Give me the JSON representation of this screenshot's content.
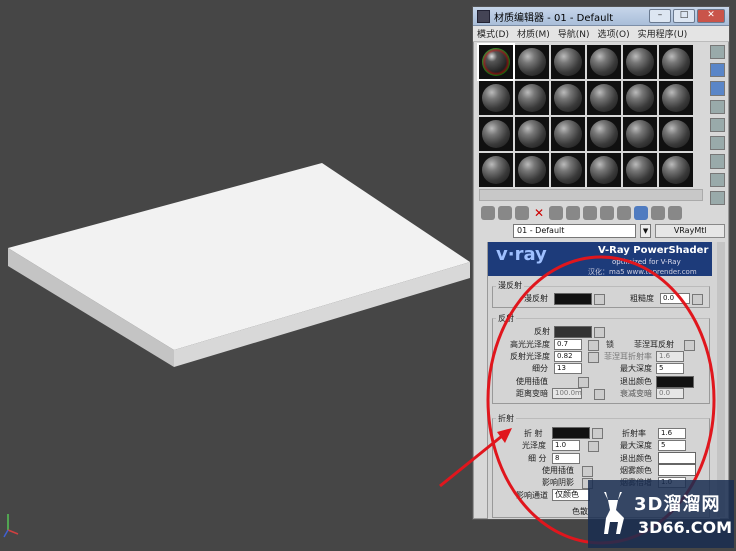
{
  "window": {
    "title": "材质编辑器 - 01 - Default",
    "menu": [
      "模式(D)",
      "材质(M)",
      "导航(N)",
      "选项(O)",
      "实用程序(U)"
    ]
  },
  "material": {
    "name": "01 - Default",
    "type_button": "VRayMtl"
  },
  "banner": {
    "brand": "v·ray",
    "product": "V-Ray PowerShader",
    "tagline": "optimized for V-Ray",
    "localized": "汉化：ma5  www.toprender.com"
  },
  "diffuse": {
    "group": "漫反射",
    "label": "漫反射",
    "roughness_label": "粗糙度",
    "roughness": "0.0"
  },
  "reflection": {
    "group": "反射",
    "reflect_label": "反射",
    "hilight_gloss_label": "高光光泽度",
    "hilight_gloss": "0.7",
    "lock_label": "锁",
    "fresnel_label": "菲涅耳反射",
    "refl_gloss_label": "反射光泽度",
    "refl_gloss": "0.82",
    "fresnel_ior_label": "菲涅耳折射率",
    "fresnel_ior": "1.6",
    "subdivs_label": "细分",
    "subdivs": "13",
    "max_depth_label": "最大深度",
    "max_depth": "5",
    "interp_label": "使用插值",
    "exit_color_label": "退出颜色",
    "dim_dist_label": "距离变暗",
    "dim_dist": "100.0m",
    "dim_falloff_label": "衰减变暗",
    "dim_falloff": "0.0"
  },
  "refraction": {
    "group": "折射",
    "refract_label": "折 射",
    "ior_label": "折射率",
    "ior": "1.6",
    "gloss_label": "光泽度",
    "gloss": "1.0",
    "max_depth_label": "最大深度",
    "max_depth": "5",
    "subdivs_label": "细 分",
    "subdivs": "8",
    "exit_color_label": "退出颜色",
    "interp_label": "使用插值",
    "fog_color_label": "烟雾颜色",
    "shadows_label": "影响阴影",
    "fog_mult_label": "烟雾倍增",
    "fog_mult": "1.0",
    "channels_label": "影响通道",
    "channels": "仅颜色",
    "dispersion_label": "色散"
  },
  "watermark": {
    "line1": "3D溜溜网",
    "line2": "3D66.COM"
  },
  "colors": {
    "viewport": "#464646",
    "annotation": "#e0161d"
  }
}
